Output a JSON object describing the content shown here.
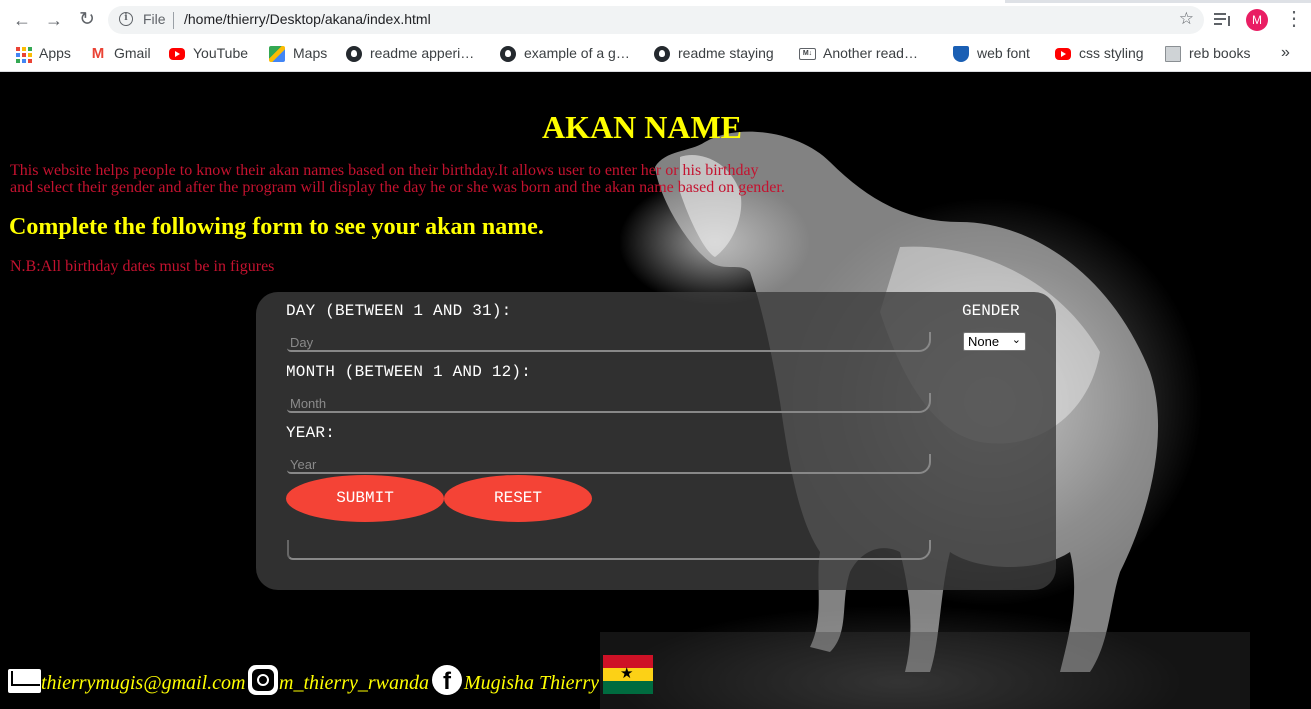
{
  "browser": {
    "scheme_label": "File",
    "url": "/home/thierry/Desktop/akana/index.html",
    "avatar_letter": "M",
    "bookmarks": [
      {
        "label": "Apps",
        "icon": "apps-grid-icon"
      },
      {
        "label": "Gmail",
        "icon": "gmail-icon"
      },
      {
        "label": "YouTube",
        "icon": "youtube-icon"
      },
      {
        "label": "Maps",
        "icon": "maps-icon"
      },
      {
        "label": "readme apperi…",
        "icon": "github-icon"
      },
      {
        "label": "example of a g…",
        "icon": "github-icon"
      },
      {
        "label": "readme staying",
        "icon": "github-icon"
      },
      {
        "label": "Another read…",
        "icon": "markdown-icon"
      },
      {
        "label": "web font",
        "icon": "shield-icon"
      },
      {
        "label": "css styling",
        "icon": "youtube-icon"
      },
      {
        "label": "reb books",
        "icon": "book-icon"
      }
    ],
    "more_label": "»"
  },
  "page": {
    "title": "AKAN NAME",
    "description_line1": "This website helps people to know their akan names based on their birthday.It allows user to enter her or his birthday",
    "description_line2": "and select their gender and after the program will display the day he or she was born and the akan name based on gender.",
    "subtitle": "Complete the following form to see your akan name.",
    "note": "N.B:All birthday dates must be in figures"
  },
  "form": {
    "day_label": "DAY (BETWEEN 1 AND 31):",
    "day_placeholder": "Day",
    "month_label": "MONTH (BETWEEN 1 AND 12):",
    "month_placeholder": "Month",
    "year_label": "YEAR:",
    "year_placeholder": "Year",
    "gender_label": "GENDER",
    "gender_selected": "None",
    "submit_label": "SUBMIT",
    "reset_label": "RESET",
    "result_text": ""
  },
  "footer": {
    "email": "thierrymugis@gmail.com",
    "instagram": "m_thierry_rwanda",
    "facebook": "Mugisha Thierry"
  },
  "colors": {
    "title": "#ffff00",
    "description": "#c4122f",
    "button": "#f44336"
  }
}
